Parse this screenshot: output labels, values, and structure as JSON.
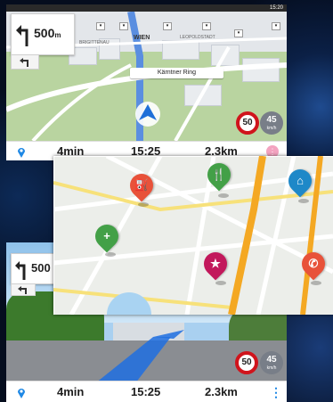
{
  "status_time": "15:20",
  "nav": {
    "distance": "500",
    "distance_unit": "m",
    "ar_distance": "500"
  },
  "map_labels": {
    "city": "WIEN",
    "district_left": "BRIGITTENAU",
    "district_right": "LEOPOLDSTADT",
    "street": "Kärntner Ring"
  },
  "speed": {
    "limit": "50",
    "current": "45",
    "unit": "km/h"
  },
  "info_bar": {
    "time_remaining": "4min",
    "arrival": "15:25",
    "distance_remaining": "2.3km"
  },
  "ar_info_bar": {
    "time_remaining": "4min",
    "arrival": "15:25",
    "distance_remaining": "2.3km"
  },
  "pois": [
    {
      "icon": "gas-station-icon",
      "color": "#e8523a"
    },
    {
      "icon": "restaurant-icon",
      "color": "#43a047"
    },
    {
      "icon": "home-icon",
      "color": "#1e88c8"
    },
    {
      "icon": "hospital-icon",
      "color": "#43a047"
    },
    {
      "icon": "favorite-star-icon",
      "color": "#c2185b"
    },
    {
      "icon": "phone-icon",
      "color": "#e8523a"
    }
  ],
  "colors": {
    "accent_blue": "#1565c0",
    "speed_red": "#d0141c",
    "location_pin": "#1e88e5"
  }
}
